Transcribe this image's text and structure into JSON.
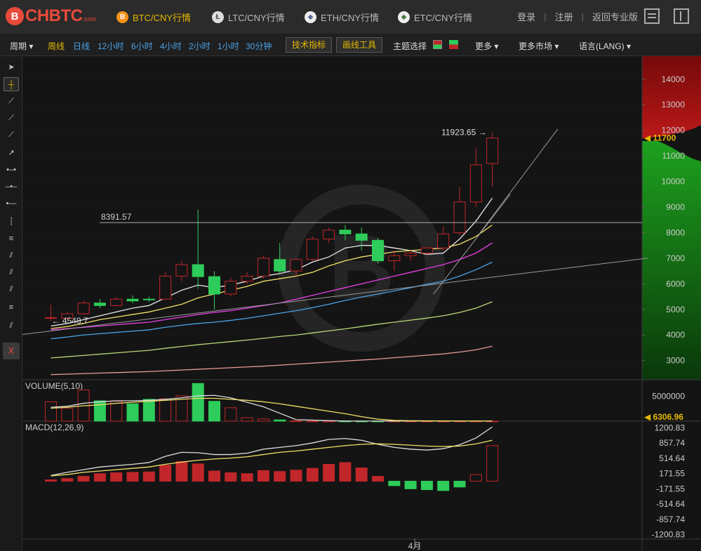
{
  "brand": {
    "logo_mark": "B",
    "logo_text": "CHBTC",
    "logo_suffix": ".com"
  },
  "markets": [
    {
      "label": "BTC/CNY行情",
      "icon": "bitcoin-icon",
      "icon_glyph": "B",
      "color": "#f7931a",
      "active": true
    },
    {
      "label": "LTC/CNY行情",
      "icon": "litecoin-icon",
      "icon_glyph": "Ł",
      "color": "#bbbbbb",
      "active": false
    },
    {
      "label": "ETH/CNY行情",
      "icon": "ethereum-icon",
      "icon_glyph": "◆",
      "color": "#7b8cbf",
      "active": false
    },
    {
      "label": "ETC/CNY行情",
      "icon": "ethereum-classic-icon",
      "icon_glyph": "◆",
      "color": "#6d9e63",
      "active": false
    }
  ],
  "top_links": {
    "login": "登录",
    "register": "注册",
    "pro": "返回专业版"
  },
  "menu": {
    "period": "周期",
    "intervals": [
      "周线",
      "日线",
      "12小时",
      "6小时",
      "4小时",
      "2小时",
      "1小时",
      "30分钟"
    ],
    "indicators": "技术指标",
    "draw_tools": "画线工具",
    "theme": "主题选择",
    "more": "更多",
    "more_markets": "更多市场",
    "language": "语言(LANG)"
  },
  "colors": {
    "up": "#c0262a",
    "down": "#2ecc5a",
    "accent": "#e6b800",
    "ma5": "#e8e8e8",
    "ma10": "#f0e068",
    "ma20": "#e83ee8",
    "ma30": "#4aa3e8",
    "ma60": "#b8d878",
    "ma120": "#e89a9a"
  },
  "chart_data": {
    "type": "candlestick",
    "title": "",
    "price_axis": {
      "ticks": [
        3000,
        4000,
        5000,
        6000,
        7000,
        8000,
        9000,
        10000,
        11000,
        12000,
        13000,
        14000
      ],
      "ylim": [
        2250,
        14900
      ]
    },
    "current_price": "11700",
    "high_label": "11923.65 →",
    "low_label": "← 4548.7",
    "reference_line": {
      "value": 8391.57,
      "label": "8391.57"
    },
    "x_label": "4月",
    "candles": [
      {
        "o": 4650,
        "c": 4680,
        "h": 5180,
        "l": 4548.7
      },
      {
        "o": 4650,
        "c": 4830,
        "h": 4900,
        "l": 4600
      },
      {
        "o": 4830,
        "c": 5250,
        "h": 5350,
        "l": 4800
      },
      {
        "o": 5250,
        "c": 5150,
        "h": 5400,
        "l": 5050
      },
      {
        "o": 5150,
        "c": 5400,
        "h": 5480,
        "l": 5100
      },
      {
        "o": 5400,
        "c": 5330,
        "h": 5550,
        "l": 5250
      },
      {
        "o": 5400,
        "c": 5380,
        "h": 5500,
        "l": 5300
      },
      {
        "o": 5400,
        "c": 6300,
        "h": 6450,
        "l": 5350
      },
      {
        "o": 6300,
        "c": 6750,
        "h": 6900,
        "l": 6100
      },
      {
        "o": 6750,
        "c": 6280,
        "h": 8900,
        "l": 5800
      },
      {
        "o": 6280,
        "c": 5600,
        "h": 6500,
        "l": 5000
      },
      {
        "o": 5600,
        "c": 6100,
        "h": 6250,
        "l": 5500
      },
      {
        "o": 6100,
        "c": 6300,
        "h": 6450,
        "l": 6000
      },
      {
        "o": 6300,
        "c": 7000,
        "h": 7100,
        "l": 6200
      },
      {
        "o": 6950,
        "c": 6500,
        "h": 7600,
        "l": 6400
      },
      {
        "o": 6500,
        "c": 6950,
        "h": 7000,
        "l": 6300
      },
      {
        "o": 6950,
        "c": 7750,
        "h": 7850,
        "l": 6900
      },
      {
        "o": 7750,
        "c": 8100,
        "h": 8200,
        "l": 7600
      },
      {
        "o": 8100,
        "c": 7950,
        "h": 8300,
        "l": 7700
      },
      {
        "o": 7950,
        "c": 7700,
        "h": 8200,
        "l": 7300
      },
      {
        "o": 7700,
        "c": 6900,
        "h": 7800,
        "l": 6800
      },
      {
        "o": 6900,
        "c": 7100,
        "h": 7300,
        "l": 6500
      },
      {
        "o": 7100,
        "c": 7200,
        "h": 7300,
        "l": 6900
      },
      {
        "o": 7200,
        "c": 7400,
        "h": 7450,
        "l": 7100
      },
      {
        "o": 7400,
        "c": 7950,
        "h": 8250,
        "l": 7300
      },
      {
        "o": 8000,
        "c": 9200,
        "h": 9800,
        "l": 7900
      },
      {
        "o": 9200,
        "c": 10650,
        "h": 11300,
        "l": 9000
      },
      {
        "o": 10700,
        "c": 11700,
        "h": 11923.65,
        "l": 9800
      }
    ],
    "moving_averages": [
      {
        "color_key": "ma5",
        "values": [
          4350,
          4450,
          4600,
          4750,
          4900,
          5050,
          5150,
          5450,
          5750,
          5950,
          5850,
          5950,
          6100,
          6300,
          6400,
          6550,
          6850,
          7050,
          7400,
          7500,
          7500,
          7400,
          7300,
          7150,
          7200,
          7750,
          8450,
          9350
        ]
      },
      {
        "color_key": "ma10",
        "values": [
          4250,
          4330,
          4450,
          4600,
          4700,
          4800,
          4900,
          5050,
          5200,
          5450,
          5600,
          5750,
          5900,
          6100,
          6200,
          6300,
          6450,
          6700,
          6900,
          7050,
          7150,
          7250,
          7300,
          7350,
          7400,
          7550,
          7850,
          8300
        ]
      },
      {
        "color_key": "ma20",
        "values": [
          4200,
          4250,
          4300,
          4350,
          4400,
          4450,
          4500,
          4600,
          4700,
          4800,
          4880,
          4950,
          5050,
          5150,
          5250,
          5400,
          5550,
          5700,
          5850,
          6000,
          6150,
          6300,
          6450,
          6600,
          6750,
          6950,
          7200,
          7600
        ]
      },
      {
        "color_key": "ma30",
        "values": [
          3850,
          3920,
          4000,
          4050,
          4100,
          4150,
          4200,
          4300,
          4380,
          4450,
          4500,
          4570,
          4650,
          4750,
          4850,
          4950,
          5070,
          5200,
          5350,
          5480,
          5600,
          5720,
          5850,
          5980,
          6100,
          6300,
          6550,
          6850
        ]
      },
      {
        "color_key": "ma60",
        "values": [
          3100,
          3150,
          3200,
          3250,
          3300,
          3350,
          3400,
          3480,
          3550,
          3620,
          3680,
          3740,
          3800,
          3870,
          3940,
          4000,
          4080,
          4160,
          4240,
          4330,
          4420,
          4500,
          4580,
          4660,
          4750,
          4880,
          5050,
          5300
        ]
      },
      {
        "color_key": "ma120",
        "values": [
          2450,
          2470,
          2490,
          2510,
          2530,
          2550,
          2570,
          2600,
          2630,
          2660,
          2690,
          2720,
          2750,
          2780,
          2820,
          2860,
          2900,
          2940,
          2980,
          3020,
          3060,
          3110,
          3160,
          3210,
          3260,
          3330,
          3420,
          3560
        ]
      }
    ],
    "trendlines": [
      {
        "from": [
          -2,
          4000
        ],
        "to": [
          36.5,
          7000
        ]
      },
      {
        "from": [
          23.4,
          5600
        ],
        "to": [
          28.1,
          9500
        ]
      },
      {
        "from": [
          26.2,
          7950
        ],
        "to": [
          31.0,
          12050
        ]
      }
    ],
    "volume": {
      "title": "VOLUME(5,10)",
      "tick": "5000000",
      "current_label": "6306.96",
      "ylim": [
        0,
        7500000
      ],
      "values": [
        3900000,
        2600000,
        6300000,
        4100000,
        4000000,
        3500000,
        4400000,
        4500000,
        5100000,
        7600000,
        4000000,
        2700000,
        700000,
        450000,
        250000,
        50000,
        25000,
        15000,
        12000,
        10000,
        8000,
        6000,
        6000,
        6000,
        6000,
        7000,
        7000,
        6307
      ],
      "ma5": [
        2800000,
        3000000,
        3600000,
        3900000,
        4100000,
        4100000,
        4200000,
        4400000,
        4700000,
        5100000,
        5200000,
        4700000,
        3800000,
        2900000,
        1600000,
        300000,
        200000,
        100000,
        30000,
        20000,
        20000,
        20000,
        20000,
        20000,
        20000,
        20000,
        20000,
        20000
      ],
      "ma10": [
        2600000,
        2800000,
        3100000,
        3300000,
        3600000,
        3800000,
        4000000,
        4200000,
        4400000,
        4600000,
        4600000,
        4400000,
        4200000,
        3900000,
        3500000,
        3000000,
        2500000,
        2000000,
        1500000,
        900000,
        400000,
        150000,
        80000,
        60000,
        50000,
        40000,
        30000,
        20000
      ]
    },
    "macd": {
      "title": "MACD(12,26,9)",
      "ticks": [
        "1200.83",
        "857.74",
        "514.64",
        "171.55",
        "-171.55",
        "-514.64",
        "-857.74",
        "-1200.83"
      ],
      "ylim": [
        -1300,
        1350
      ],
      "dif": [
        130,
        200,
        260,
        320,
        350,
        380,
        420,
        560,
        650,
        640,
        600,
        600,
        630,
        720,
        760,
        800,
        860,
        940,
        960,
        920,
        830,
        760,
        720,
        700,
        730,
        820,
        970,
        1220
      ],
      "dea": [
        120,
        150,
        200,
        230,
        260,
        290,
        320,
        380,
        430,
        470,
        500,
        520,
        550,
        600,
        650,
        680,
        720,
        760,
        800,
        830,
        840,
        830,
        810,
        790,
        780,
        790,
        840,
        920
      ],
      "hist": [
        30,
        60,
        110,
        170,
        190,
        200,
        210,
        360,
        440,
        390,
        230,
        190,
        170,
        240,
        220,
        250,
        290,
        380,
        420,
        300,
        110,
        -100,
        -170,
        -190,
        -210,
        -130,
        150,
        800
      ]
    }
  }
}
